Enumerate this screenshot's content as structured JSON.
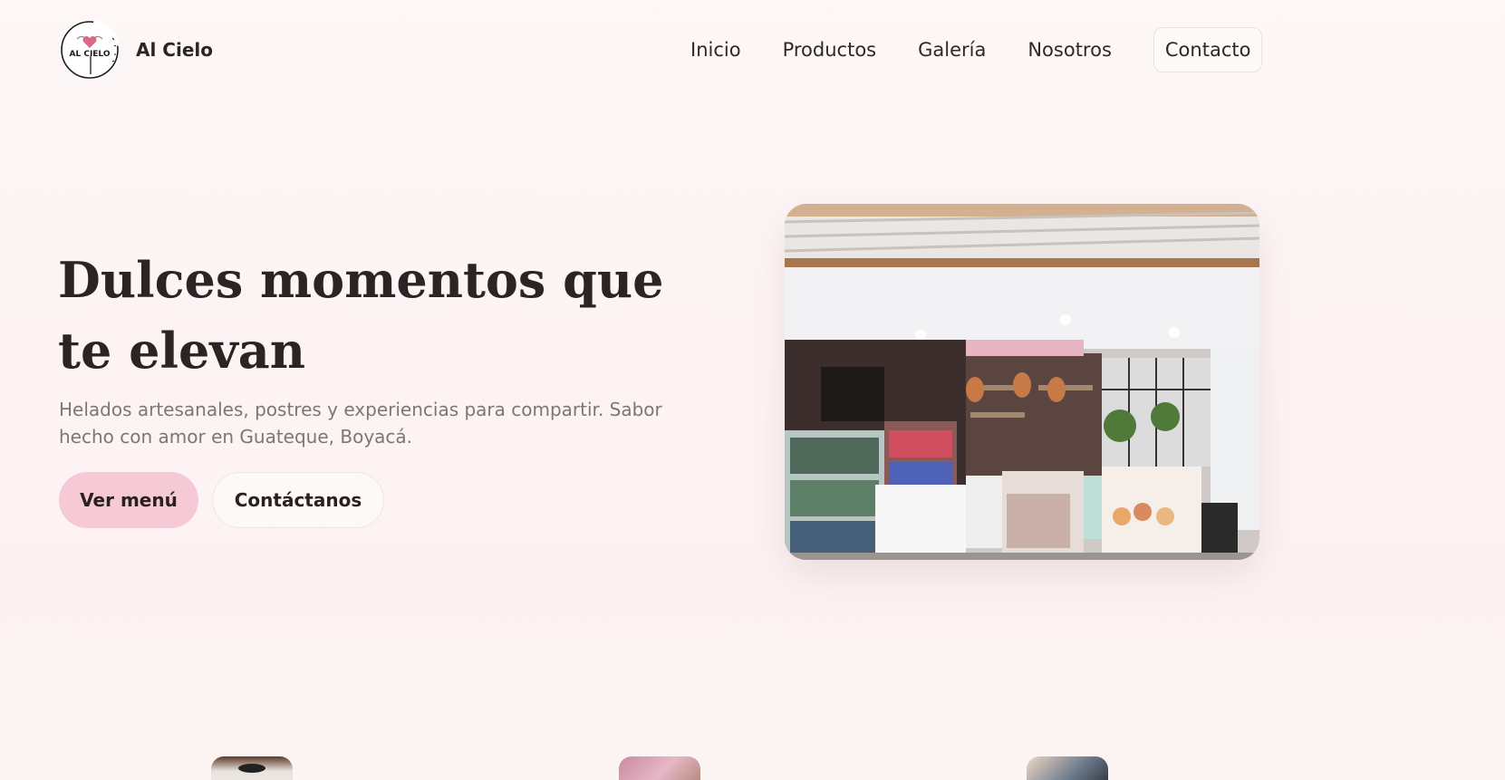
{
  "brand": {
    "name": "Al Cielo",
    "logo_text": "AL CIELO",
    "logo_icon": "heart-wings-icon"
  },
  "nav": {
    "items": [
      {
        "label": "Inicio"
      },
      {
        "label": "Productos"
      },
      {
        "label": "Galería"
      },
      {
        "label": "Nosotros"
      },
      {
        "label": "Contacto"
      }
    ]
  },
  "hero": {
    "title": "Dulces momentos que te elevan",
    "subtitle": "Helados artesanales, postres y experiencias para compartir. Sabor hecho con amor en Guateque, Boyacá.",
    "primary_button": "Ver menú",
    "secondary_button": "Contáctanos",
    "photo_subject": "storefront of the ice cream shop"
  },
  "colors": {
    "accent_pink": "#f6c9d7",
    "text_dark": "#2a2424",
    "text_muted": "#7e7575",
    "background": "#fdf5f4"
  }
}
